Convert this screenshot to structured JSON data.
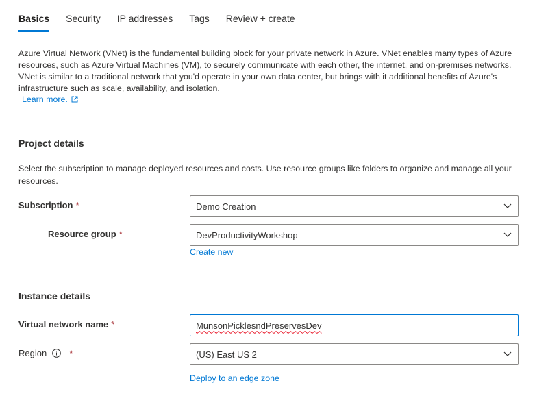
{
  "tabs": [
    "Basics",
    "Security",
    "IP addresses",
    "Tags",
    "Review + create"
  ],
  "intro": {
    "text": "Azure Virtual Network (VNet) is the fundamental building block for your private network in Azure. VNet enables many types of Azure resources, such as Azure Virtual Machines (VM), to securely communicate with each other, the internet, and on-premises networks. VNet is similar to a traditional network that you'd operate in your own data center, but brings with it additional benefits of Azure's infrastructure such as scale, availability, and isolation.",
    "learn_more": "Learn more."
  },
  "project": {
    "title": "Project details",
    "description": "Select the subscription to manage deployed resources and costs. Use resource groups like folders to organize and manage all your resources.",
    "subscription_label": "Subscription",
    "subscription_value": "Demo Creation",
    "resource_group_label": "Resource group",
    "resource_group_value": "DevProductivityWorkshop",
    "create_new": "Create new"
  },
  "instance": {
    "title": "Instance details",
    "vnet_name_label": "Virtual network name",
    "vnet_name_value": "MunsonPicklesndPreservesDev",
    "region_label": "Region",
    "region_value": "(US) East US 2",
    "edge_zone": "Deploy to an edge zone"
  },
  "required_marker": "*",
  "colors": {
    "accent": "#0078d4",
    "required": "#a4262c",
    "text": "#323130"
  }
}
